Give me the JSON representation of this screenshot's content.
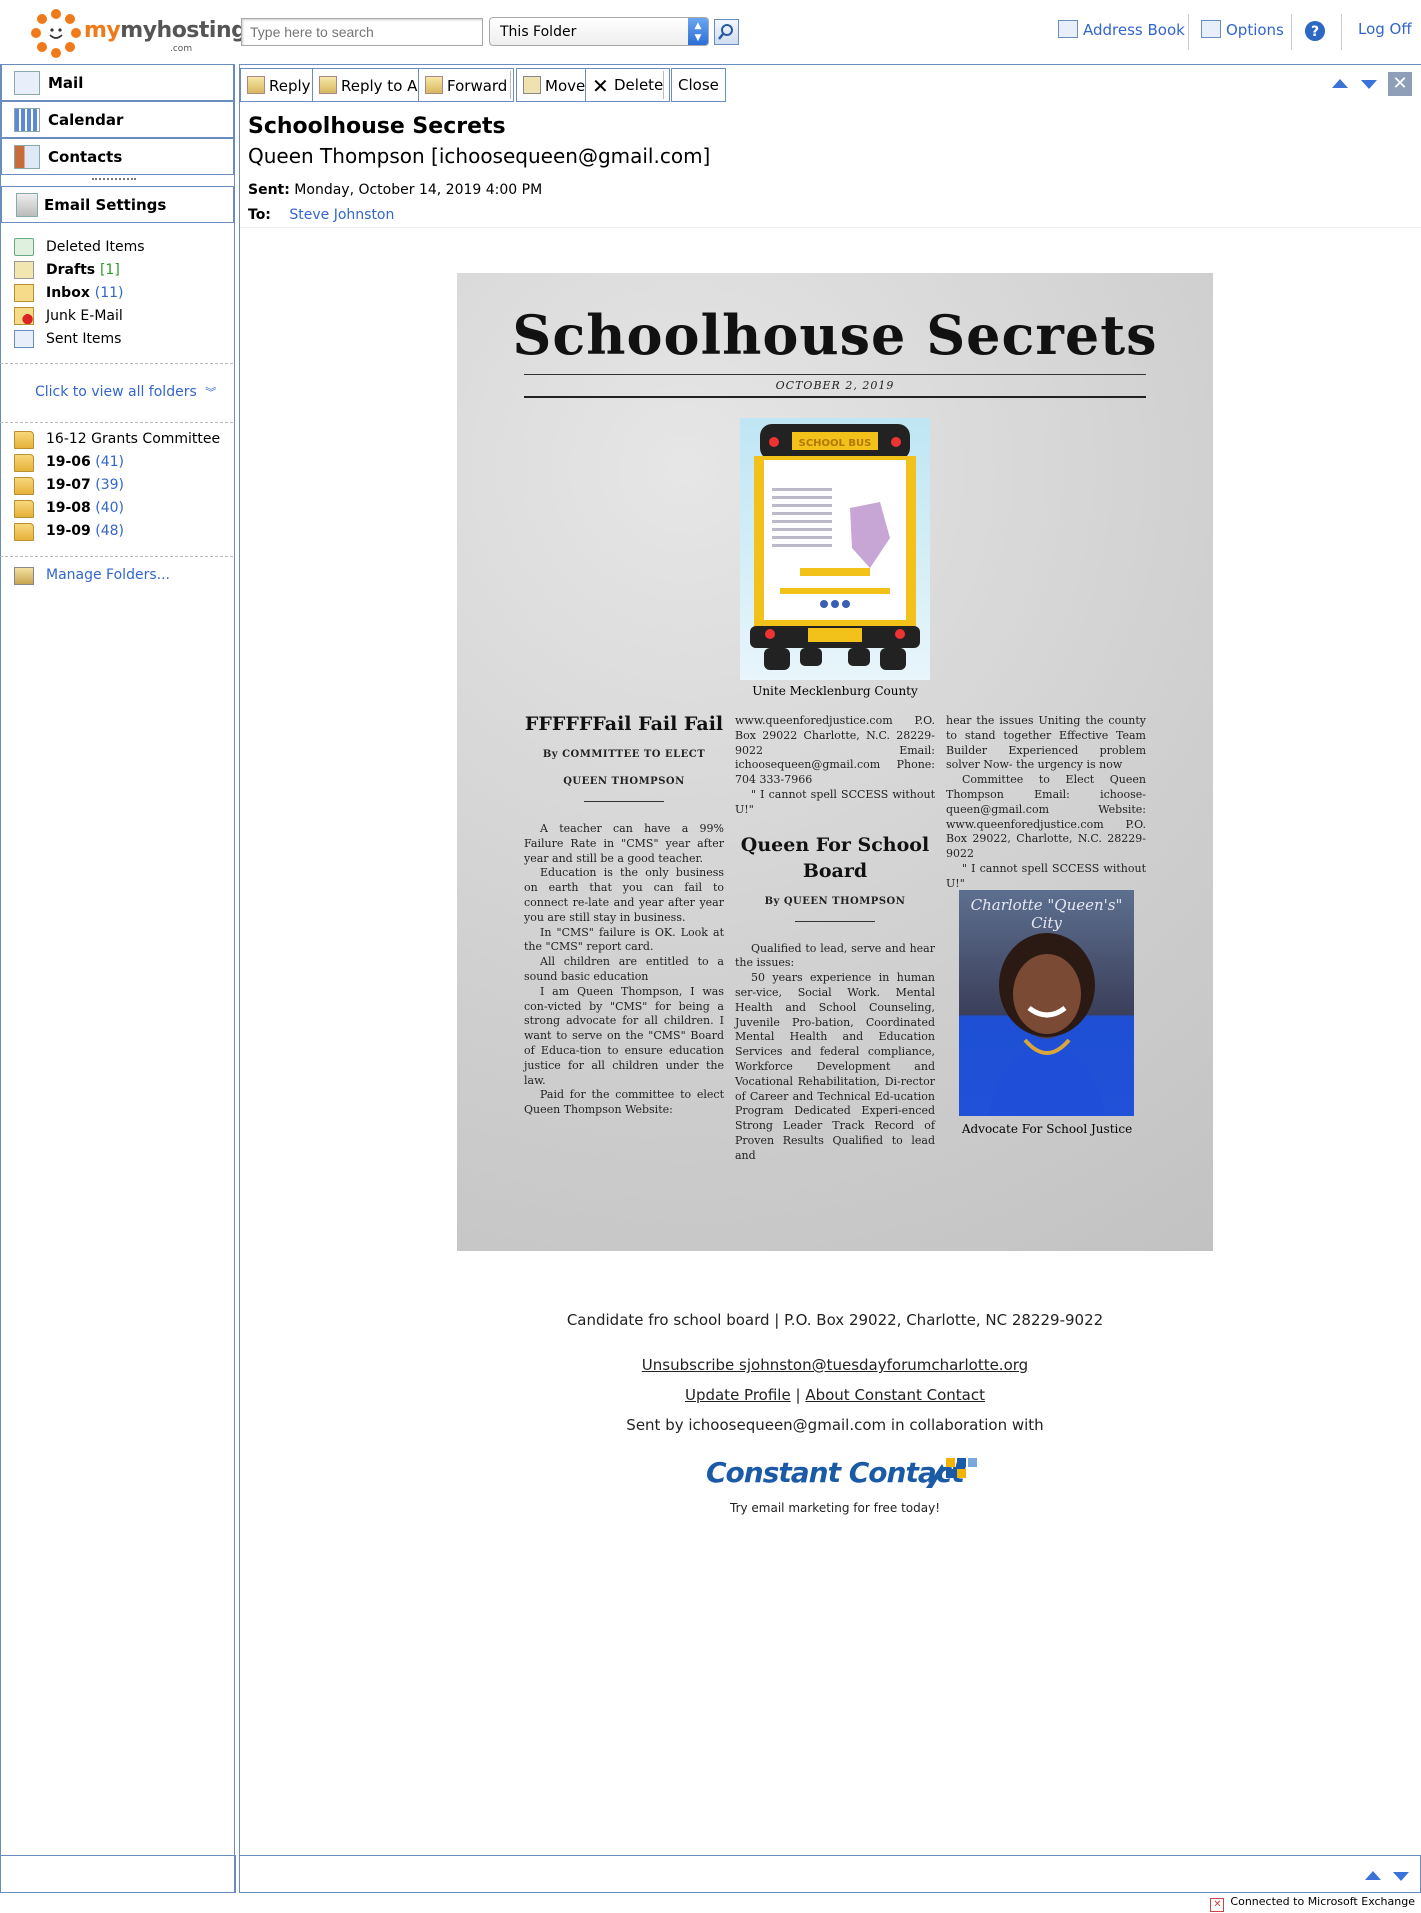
{
  "top": {
    "logo_text": "myhosting",
    "logo_suffix": ".com",
    "search_placeholder": "Type here to search",
    "folder_scope": "This Folder",
    "address_book": "Address Book",
    "options": "Options",
    "logoff": "Log Off"
  },
  "nav": {
    "mail": "Mail",
    "calendar": "Calendar",
    "contacts": "Contacts",
    "email_settings": "Email Settings"
  },
  "folders": [
    {
      "name": "Deleted Items",
      "count": "",
      "bold": false
    },
    {
      "name": "Drafts",
      "count": "[1]",
      "bold": true
    },
    {
      "name": "Inbox",
      "count": "(11)",
      "bold": true
    },
    {
      "name": "Junk E-Mail",
      "count": "",
      "bold": false
    },
    {
      "name": "Sent Items",
      "count": "",
      "bold": false
    }
  ],
  "view_all": "Click to view all folders",
  "sub_folders": [
    {
      "name": "16-12 Grants Committee",
      "count": "",
      "bold": false
    },
    {
      "name": "19-06",
      "count": "(41)",
      "bold": true
    },
    {
      "name": "19-07",
      "count": "(39)",
      "bold": true
    },
    {
      "name": "19-08",
      "count": "(40)",
      "bold": true
    },
    {
      "name": "19-09",
      "count": "(48)",
      "bold": true
    }
  ],
  "manage_folders": "Manage Folders...",
  "toolbar": {
    "reply": "Reply",
    "reply_all": "Reply to All",
    "forward": "Forward",
    "move": "Move",
    "delete": "Delete",
    "close": "Close"
  },
  "message": {
    "subject": "Schoolhouse Secrets",
    "from": "Queen Thompson [ichoosequeen@gmail.com]",
    "sent_label": "Sent:",
    "sent_value": "Monday, October 14, 2019 4:00 PM",
    "to_label": "To:",
    "to_value": "Steve Johnston"
  },
  "newsletter": {
    "masthead": "Schoolhouse Secrets",
    "date": "OCTOBER 2, 2019",
    "bus_sign": "SCHOOL BUS",
    "bus_caption": "Unite Mecklenburg County",
    "col1_title": "FFFFFFail Fail Fail",
    "col1_by1": "By COMMITTEE TO ELECT",
    "col1_by2": "QUEEN THOMPSON",
    "col1_paras": [
      "A teacher can have a 99% Failure Rate in \"CMS\" year after year and still be a good teacher.",
      "Education is the only business on earth that you can fail to connect re-late and year after year you are still stay in business.",
      "In \"CMS\" failure is OK. Look at the \"CMS\" report card.",
      "All children are entitled to a sound basic education",
      "I am Queen Thompson, I was con-victed by \"CMS\" for being a strong advocate for all children. I want to serve on the \"CMS\" Board of Educa-tion to ensure education justice for all children under the law.",
      "Paid for the committee to elect Queen Thompson Website:"
    ],
    "col2_top": "www.queenforedjustice.com P.O. Box 29022 Charlotte, N.C. 28229- 9022 Email: ichoosequeen@gmail.com Phone: 704 333-7966",
    "col2_quote": "\" I cannot spell SCCESS without U!\"",
    "col2_title": "Queen For School Board",
    "col2_by": "By QUEEN THOMPSON",
    "col2_paras": [
      "Qualified to lead, serve and hear the issues:",
      "50 years experience in human ser-vice, Social Work. Mental Health and School Counseling, Juvenile Pro-bation, Coordinated Mental Health and Education Services and federal compliance, Workforce Development and Vocational Rehabilitation, Di-rector of Career and Technical Ed-ucation Program Dedicated Experi-enced Strong Leader Track Record of Proven Results Qualified to lead and"
    ],
    "col3_top": "hear the issues Uniting the county to stand together Effective Team Builder Experienced problem solver Now- the urgency is now",
    "col3_para": "Committee to Elect Queen Thompson Email: ichoose-queen@gmail.com Website: www.queenforedjustice.com P.O. Box 29022, Charlotte, N.C. 28229-9022",
    "col3_quote": "\" I cannot spell SCCESS without U!\"",
    "portrait_script": "Charlotte \"Queen's\" City",
    "portrait_caption": "Advocate For School Justice"
  },
  "footer": {
    "address": "Candidate fro school board | P.O. Box 29022, Charlotte, NC 28229-9022",
    "unsubscribe": "Unsubscribe sjohnston@tuesdayforumcharlotte.org",
    "update_profile": "Update Profile",
    "sep": "|",
    "about": "About Constant Contact",
    "sent_by": "Sent by ichoosequeen@gmail.com in collaboration with",
    "cc_brand": "Constant Contact",
    "cc_tag": "Try email marketing for free today!"
  },
  "status": "Connected to Microsoft Exchange"
}
